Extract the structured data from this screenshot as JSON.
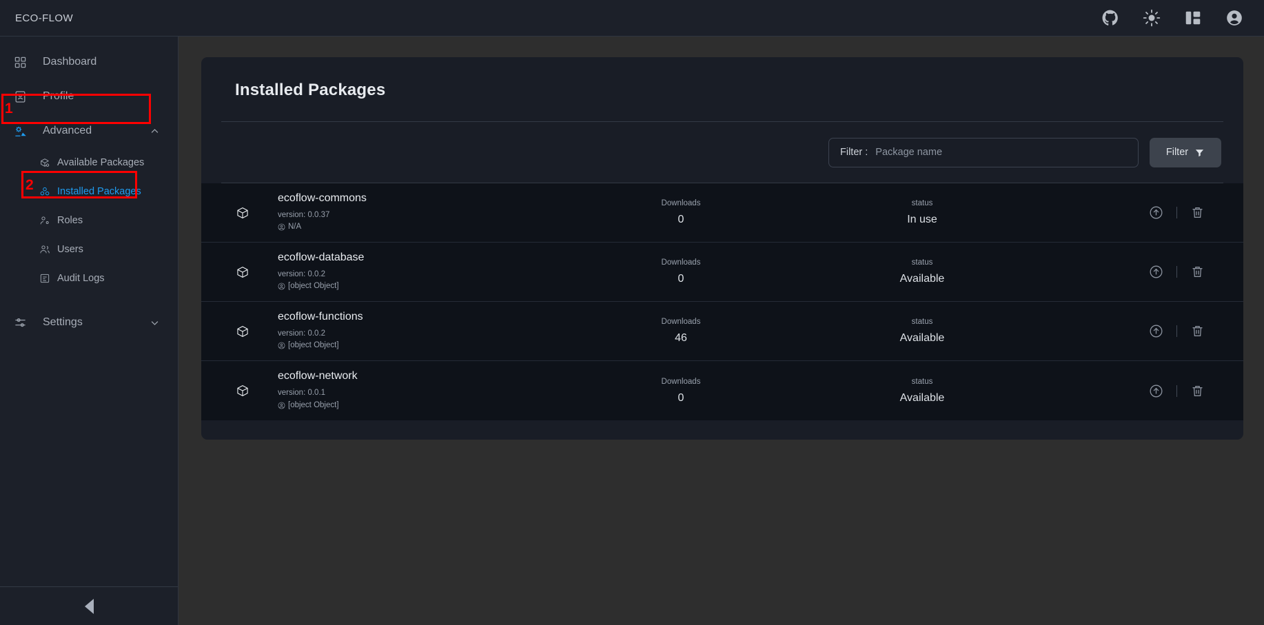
{
  "topbar": {
    "brand": "ECO-FLOW",
    "icons": [
      {
        "name": "github-icon",
        "label": "GitHub"
      },
      {
        "name": "light-mode-icon",
        "label": "Toggle theme"
      },
      {
        "name": "layout-panel-icon",
        "label": "Layout"
      },
      {
        "name": "account-icon",
        "label": "Account"
      }
    ]
  },
  "sidebar": {
    "items": [
      {
        "label": "Dashboard",
        "icon": "dashboard-icon"
      },
      {
        "label": "Profile",
        "icon": "profile-icon"
      },
      {
        "label": "Advanced",
        "icon": "advanced-icon",
        "expanded": true,
        "chevron": "chevron-up-icon"
      },
      {
        "label": "Settings",
        "icon": "settings-sliders-icon",
        "expanded": false,
        "chevron": "chevron-down-icon"
      }
    ],
    "advanced_children": [
      {
        "label": "Available Packages",
        "icon": "package-search-icon",
        "active": false
      },
      {
        "label": "Installed Packages",
        "icon": "packages-icon",
        "active": true
      },
      {
        "label": "Roles",
        "icon": "roles-icon",
        "active": false
      },
      {
        "label": "Users",
        "icon": "users-icon",
        "active": false
      },
      {
        "label": "Audit Logs",
        "icon": "audit-logs-icon",
        "active": false
      }
    ],
    "collapse_button": "collapse-sidebar-button"
  },
  "annotations": {
    "color": "#ff0000",
    "marks": [
      {
        "number": "1",
        "target": "Advanced"
      },
      {
        "number": "2",
        "target": "Installed Packages"
      }
    ]
  },
  "page": {
    "title": "Installed Packages",
    "filter": {
      "label": "Filter :",
      "placeholder": "Package name",
      "value": "",
      "button_label": "Filter",
      "button_icon": "filter-icon"
    },
    "columns": {
      "downloads": "Downloads",
      "status": "status"
    },
    "packages": [
      {
        "name": "ecoflow-commons",
        "version": "version: 0.0.37",
        "author": "N/A",
        "downloads": "0",
        "status": "In use",
        "actions": [
          "upgrade-icon",
          "delete-icon"
        ]
      },
      {
        "name": "ecoflow-database",
        "version": "version: 0.0.2",
        "author": "[object Object]",
        "downloads": "0",
        "status": "Available",
        "actions": [
          "upgrade-icon",
          "delete-icon"
        ]
      },
      {
        "name": "ecoflow-functions",
        "version": "version: 0.0.2",
        "author": "[object Object]",
        "downloads": "46",
        "status": "Available",
        "actions": [
          "upgrade-icon",
          "delete-icon"
        ]
      },
      {
        "name": "ecoflow-network",
        "version": "version: 0.0.1",
        "author": "[object Object]",
        "downloads": "0",
        "status": "Available",
        "actions": [
          "upgrade-icon",
          "delete-icon"
        ]
      }
    ]
  },
  "colors": {
    "page_background": "#2e2e2e",
    "panel_background": "#1c2029",
    "card_background": "#191d26",
    "row_background": "#0e1219",
    "accent_blue": "#1f9cf0",
    "annotation_red": "#ff0000"
  }
}
